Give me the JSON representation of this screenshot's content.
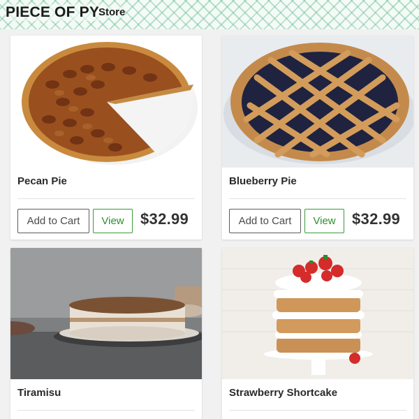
{
  "header": {
    "brand": "PIECE OF PY",
    "nav_store": "Store"
  },
  "products": [
    {
      "name": "Pecan Pie",
      "add_label": "Add to Cart",
      "view_label": "View",
      "price": "$32.99"
    },
    {
      "name": "Blueberry Pie",
      "add_label": "Add to Cart",
      "view_label": "View",
      "price": "$32.99"
    },
    {
      "name": "Tiramisu"
    },
    {
      "name": "Strawberry Shortcake"
    }
  ]
}
